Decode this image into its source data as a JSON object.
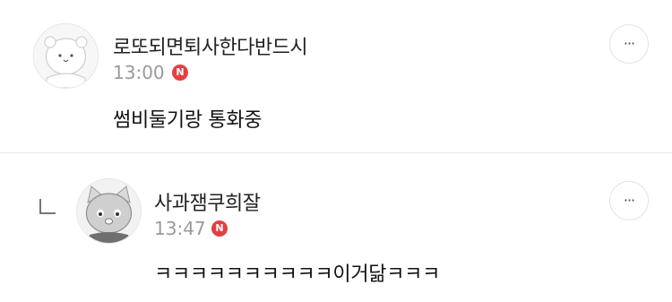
{
  "comments": [
    {
      "author": "로또되면퇴사한다반드시",
      "time": "13:00",
      "new_badge": "N",
      "text": "썸비둘기랑 통화중",
      "more_label": "···",
      "is_reply": false,
      "avatar_icon": "bear-face-avatar"
    },
    {
      "author": "사과잼쿠희잘",
      "time": "13:47",
      "new_badge": "N",
      "text": "ㅋㅋㅋㅋㅋㅋㅋㅋㅋㅋ이거닮ㅋㅋㅋ",
      "more_label": "···",
      "is_reply": true,
      "avatar_icon": "cat-face-avatar"
    }
  ],
  "colors": {
    "badge": "#e2403f",
    "time": "#9a9a9a",
    "divider": "#e9e9e9"
  }
}
